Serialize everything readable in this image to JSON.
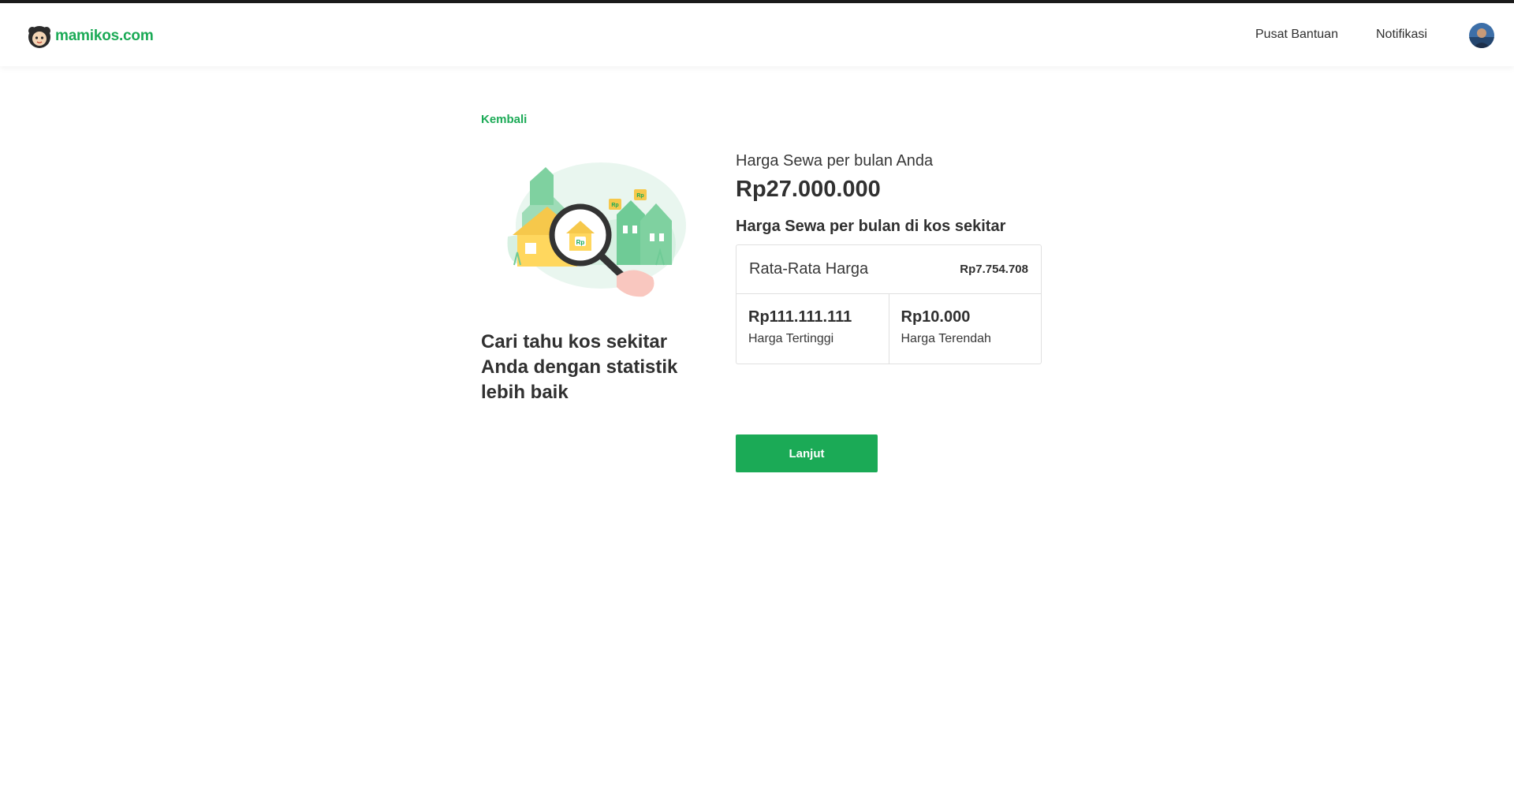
{
  "header": {
    "logo_text": "mamikos.com",
    "nav": {
      "help_label": "Pusat Bantuan",
      "notifications_label": "Notifikasi"
    }
  },
  "back_link": "Kembali",
  "promo": {
    "text": "Cari tahu kos sekitar Anda dengan statistik lebih baik",
    "illustration_badge": "Rp"
  },
  "your_price": {
    "label": "Harga Sewa per bulan Anda",
    "value": "Rp27.000.000"
  },
  "nearby": {
    "title": "Harga Sewa per bulan di kos sekitar",
    "average": {
      "label": "Rata-Rata Harga",
      "value": "Rp7.754.708"
    },
    "highest": {
      "value": "Rp111.111.111",
      "label": "Harga Tertinggi"
    },
    "lowest": {
      "value": "Rp10.000",
      "label": "Harga Terendah"
    }
  },
  "continue_button": "Lanjut",
  "colors": {
    "brand_green": "#1baa56",
    "text_dark": "#303030",
    "border": "#e0e0e0"
  },
  "icons": {
    "logo": "mascot-icon",
    "avatar": "user-avatar"
  }
}
